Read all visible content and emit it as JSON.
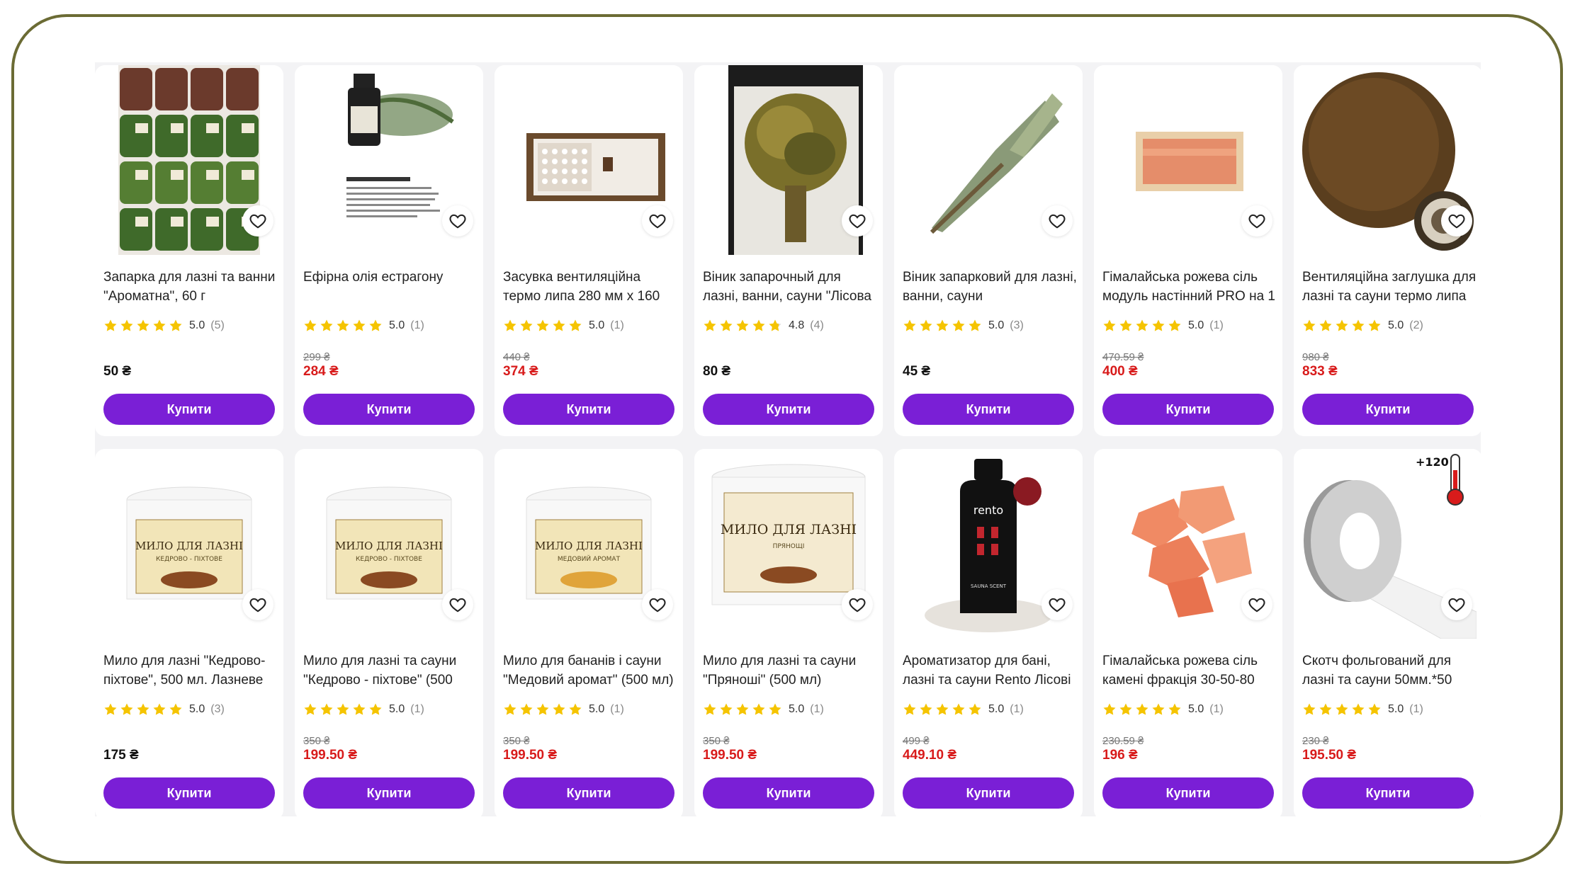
{
  "currency": "₴",
  "buy_label": "Купити",
  "products": [
    {
      "title": "Запарка для лазні та ванни \"Ароматна\", 60 г",
      "score": "5.0",
      "count": "(5)",
      "stars": 5,
      "old_price": "",
      "price": "50 ₴",
      "sale": false,
      "image": "herb-bags"
    },
    {
      "title": "Ефірна олія естрагону",
      "score": "5.0",
      "count": "(1)",
      "stars": 5,
      "old_price": "299 ₴",
      "price": "284 ₴",
      "sale": true,
      "image": "oil-bottle"
    },
    {
      "title": "Засувка вентиляційна термо липа 280 мм х 160",
      "score": "5.0",
      "count": "(1)",
      "stars": 5,
      "old_price": "440 ₴",
      "price": "374 ₴",
      "sale": true,
      "image": "vent-slider"
    },
    {
      "title": "Віник запарочный для лазні, ванни, сауни \"Лісова",
      "score": "4.8",
      "count": "(4)",
      "stars": 4.8,
      "old_price": "",
      "price": "80 ₴",
      "sale": false,
      "image": "herb-broom"
    },
    {
      "title": "Віник запарковий для лазні, ванни, сауни",
      "score": "5.0",
      "count": "(3)",
      "stars": 5,
      "old_price": "",
      "price": "45 ₴",
      "sale": false,
      "image": "grass-broom"
    },
    {
      "title": "Гімалайська рожева сіль модуль настінний PRO на 1",
      "score": "5.0",
      "count": "(1)",
      "stars": 5,
      "old_price": "470.59 ₴",
      "price": "400 ₴",
      "sale": true,
      "image": "salt-panel"
    },
    {
      "title": "Вентиляційна заглушка для лазні та сауни термо липа",
      "score": "5.0",
      "count": "(2)",
      "stars": 5,
      "old_price": "980 ₴",
      "price": "833 ₴",
      "sale": true,
      "image": "vent-cap"
    },
    {
      "title": "Мило для лазні \"Кедрово-піхтове\", 500 мл. Лазневе",
      "score": "5.0",
      "count": "(3)",
      "stars": 5,
      "old_price": "",
      "price": "175 ₴",
      "sale": false,
      "image": "soap-jar",
      "jar_label": "МИЛО ДЛЯ ЛАЗНІ",
      "jar_sub": "КЕДРОВО - ПІХТОВЕ"
    },
    {
      "title": "Мило для лазні та сауни \"Кедрово - піхтове\" (500",
      "score": "5.0",
      "count": "(1)",
      "stars": 5,
      "old_price": "350 ₴",
      "price": "199.50 ₴",
      "sale": true,
      "image": "soap-jar",
      "jar_label": "МИЛО ДЛЯ ЛАЗНІ",
      "jar_sub": "КЕДРОВО - ПІХТОВЕ"
    },
    {
      "title": "Мило для бананів і сауни \"Медовий аромат\" (500 мл)",
      "score": "5.0",
      "count": "(1)",
      "stars": 5,
      "old_price": "350 ₴",
      "price": "199.50 ₴",
      "sale": true,
      "image": "soap-jar",
      "jar_label": "МИЛО ДЛЯ ЛАЗНІ",
      "jar_sub": "МЕДОВИЙ АРОМАТ"
    },
    {
      "title": "Мило для лазні та сауни \"Пряноші\" (500 мл)",
      "score": "5.0",
      "count": "(1)",
      "stars": 5,
      "old_price": "350 ₴",
      "price": "199.50 ₴",
      "sale": true,
      "image": "soap-jar",
      "jar_label": "МИЛО ДЛЯ ЛАЗНІ",
      "jar_sub": "ПРЯНОЩІ"
    },
    {
      "title": "Ароматизатор для бані, лазні та сауни Rento Лісові",
      "score": "5.0",
      "count": "(1)",
      "stars": 5,
      "old_price": "499 ₴",
      "price": "449.10 ₴",
      "sale": true,
      "image": "rento-bottle",
      "bottle_label": "rento",
      "bottle_sub": "SAUNA SCENT"
    },
    {
      "title": "Гімалайська рожева сіль камені фракція 30-50-80",
      "score": "5.0",
      "count": "(1)",
      "stars": 5,
      "old_price": "230.59 ₴",
      "price": "196 ₴",
      "sale": true,
      "image": "salt-stones"
    },
    {
      "title": "Скотч фольгований для лазні та сауни 50мм.*50",
      "score": "5.0",
      "count": "(1)",
      "stars": 5,
      "old_price": "230 ₴",
      "price": "195.50 ₴",
      "sale": true,
      "image": "foil-tape",
      "temp_label": "+120"
    }
  ],
  "colors": {
    "accent": "#7a1fd6",
    "sale": "#d81b1b",
    "star": "#f5c400",
    "frame": "#6b6b34"
  }
}
